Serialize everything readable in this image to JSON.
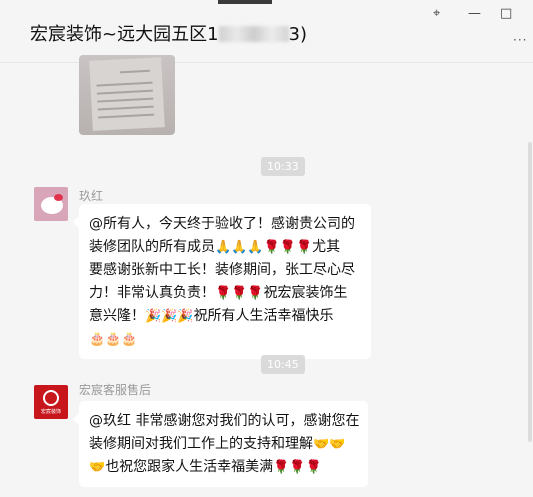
{
  "window": {
    "title_prefix": "宏宸装饰~远大园五区1",
    "title_suffix": "3)",
    "pin_icon": "pin-icon",
    "minimize_icon": "minimize-icon",
    "maximize_icon": "maximize-icon",
    "more_label": "···"
  },
  "messages": {
    "time1": "10:33",
    "sender1": "玖红",
    "msg1_lines": [
      "@所有人，今天终于验收了！感谢贵公司的",
      "装修团队的所有成员",
      "尤其",
      "要感谢张新中工长！装修期间，张工尽心尽",
      "力！非常认真负责！",
      "祝宏宸装饰生",
      "意兴隆！",
      "祝所有人生活幸福快乐"
    ],
    "time2": "10:45",
    "sender2": "宏宸客服售后",
    "avatar2_text": "宏宸装饰",
    "msg2_lines": [
      "@玖红 非常感谢您对我们的认可，感谢您在",
      "装修期间对我们工作上的支持和理解",
      "也祝您跟家人生活幸福美满"
    ],
    "emoji": {
      "pray": "🙏",
      "rose": "🌹",
      "party": "🎉",
      "cake": "🎂",
      "handshake": "🤝"
    }
  }
}
